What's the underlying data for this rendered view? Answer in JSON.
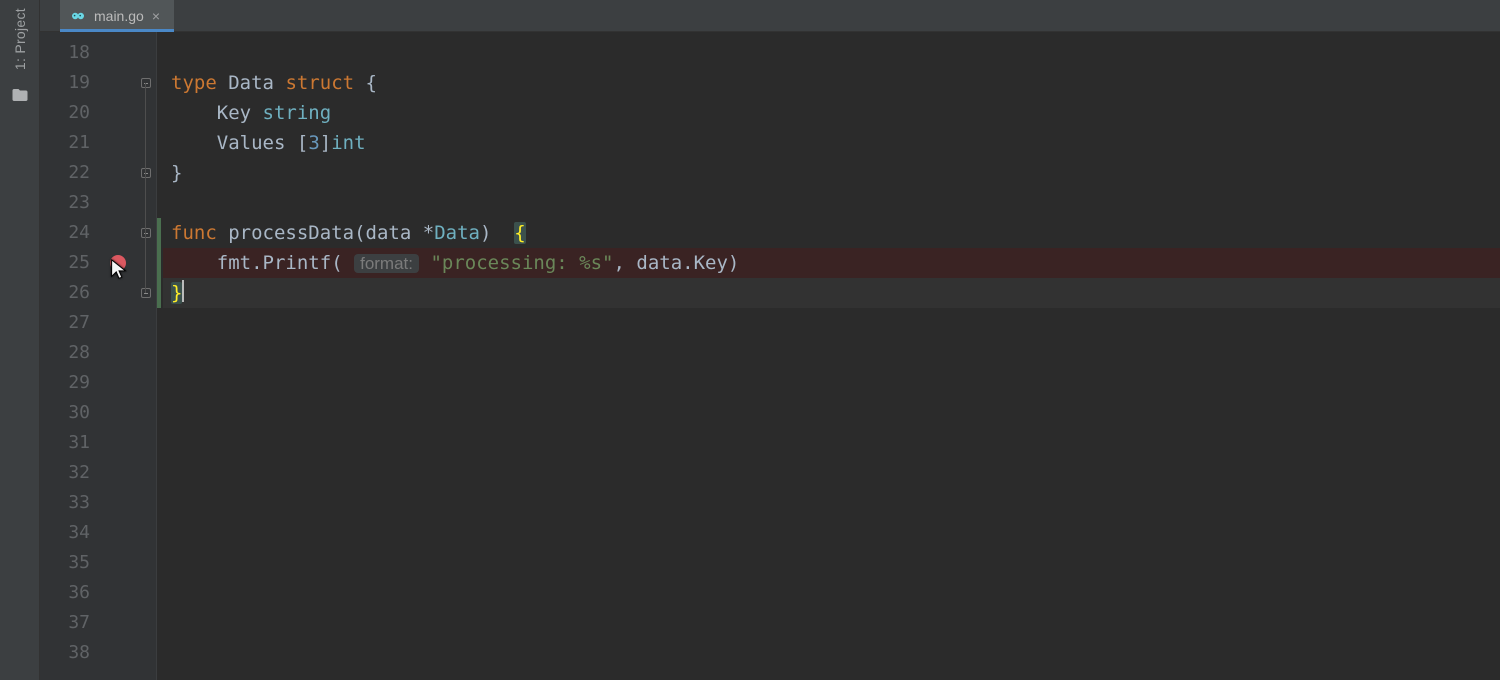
{
  "tool_window": {
    "project_label": "1: Project"
  },
  "tab": {
    "filename": "main.go",
    "icon": "go-file-icon"
  },
  "editor": {
    "first_line_number": 18,
    "line_count": 21,
    "breakpoint_line": 25,
    "caret_line": 26,
    "fold_markers": [
      19,
      22,
      24,
      26
    ],
    "change_stripe": {
      "from_line": 24,
      "to_line": 26
    },
    "code": {
      "l19": {
        "kw_type": "type",
        "name": "Data",
        "kw_struct": "struct",
        "open": "{"
      },
      "l20": {
        "field": "Key",
        "ftype": "string"
      },
      "l21": {
        "field": "Values",
        "arr_open": "[",
        "arr_n": "3",
        "arr_close": "]",
        "ftype": "int"
      },
      "l22": {
        "close": "}"
      },
      "l24": {
        "kw_func": "func",
        "fname": "processData",
        "lparen": "(",
        "param": "data",
        "star": "*",
        "ptype": "Data",
        "rparen": ")",
        "open": "{"
      },
      "l25": {
        "pkg": "fmt",
        "dot": ".",
        "call": "Printf",
        "lparen": "(",
        "hint": "format:",
        "str": "\"processing: %s\"",
        "comma": ",",
        "arg": "data.Key",
        "rparen": ")"
      },
      "l26": {
        "close": "}"
      }
    }
  }
}
